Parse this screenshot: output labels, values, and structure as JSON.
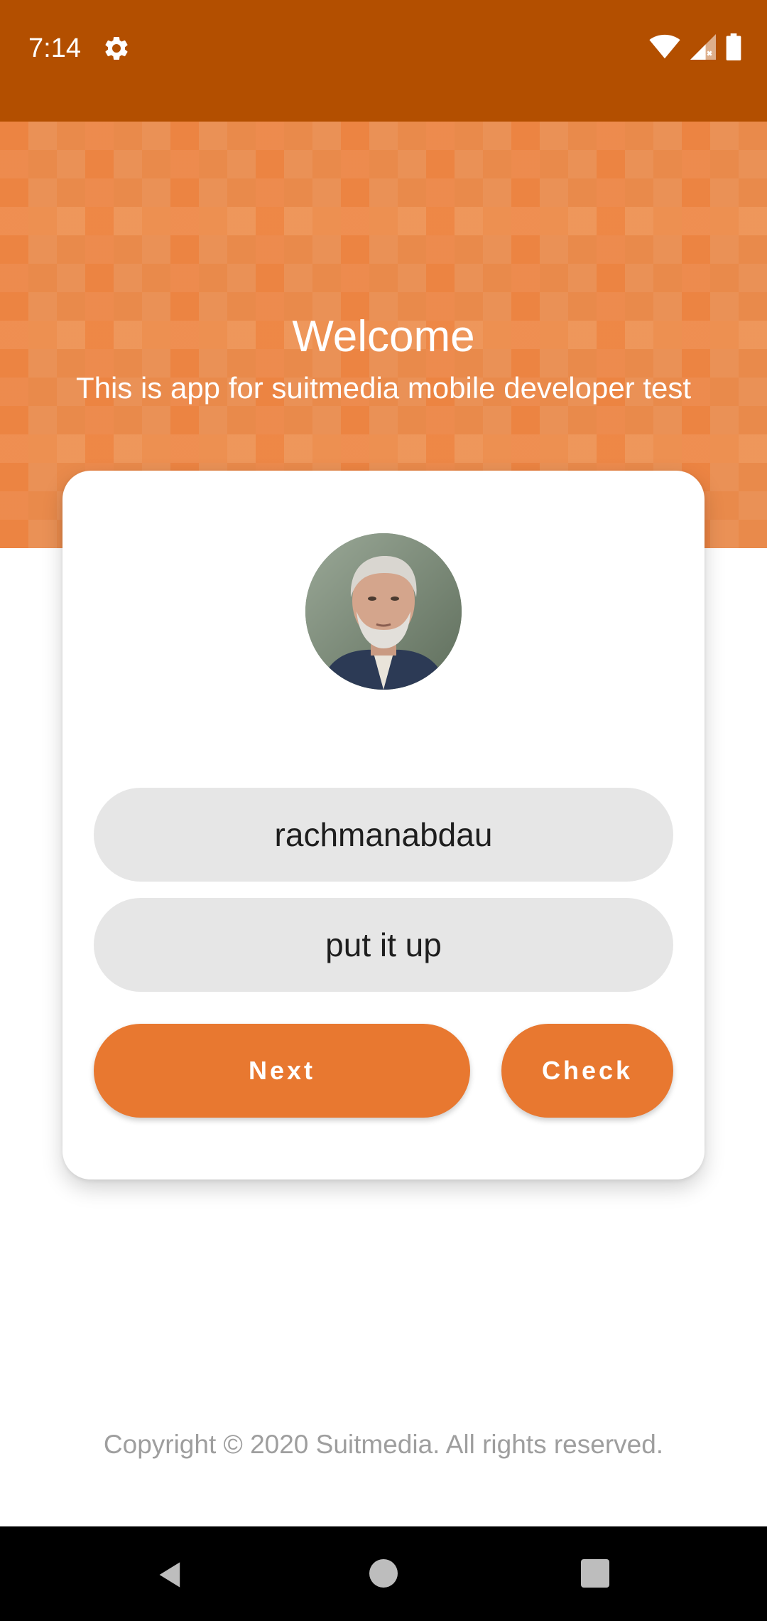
{
  "status_bar": {
    "time": "7:14",
    "icons": [
      "gear-icon",
      "wifi-icon",
      "signal-icon",
      "battery-icon"
    ]
  },
  "header": {
    "title": "Welcome",
    "subtitle": "This is app for suitmedia mobile developer test"
  },
  "card": {
    "avatar": "profile-photo",
    "name_field": {
      "value": "rachmanabdau"
    },
    "palindrome_field": {
      "value": "put it up"
    },
    "next_label": "Next",
    "check_label": "Check"
  },
  "footer": {
    "copyright": "Copyright © 2020 Suitmedia. All rights reserved."
  },
  "navigation": {
    "icons": [
      "back-icon",
      "home-icon",
      "recents-icon"
    ]
  },
  "colors": {
    "status_bar": "#b34f00",
    "hero": "#e98a4b",
    "accent": "#e87830",
    "field_bg": "#e6e6e6",
    "footer_text": "#9e9e9e"
  }
}
